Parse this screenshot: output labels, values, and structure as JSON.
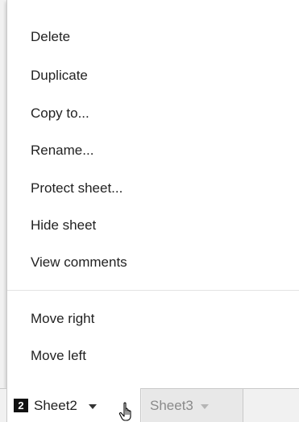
{
  "context_menu": {
    "items": [
      {
        "label": "Delete"
      },
      {
        "label": "Duplicate"
      },
      {
        "label": "Copy to..."
      },
      {
        "label": "Rename..."
      },
      {
        "label": "Protect sheet..."
      },
      {
        "label": "Hide sheet"
      },
      {
        "label": "View comments"
      },
      {
        "label": "Move right"
      },
      {
        "label": "Move left"
      }
    ]
  },
  "sheet_tabs": [
    {
      "badge": "2",
      "label": "Sheet2",
      "active": true
    },
    {
      "label": "Sheet3",
      "active": false
    }
  ],
  "icons": {
    "active_tab_arrow": "chevron-down-icon",
    "inactive_tab_arrow": "chevron-down-icon",
    "pointer": "hand-pointer-icon"
  },
  "colors": {
    "menu_text": "#222222",
    "inactive_tab_text": "#8a8a8a",
    "badge_bg": "#111111"
  }
}
